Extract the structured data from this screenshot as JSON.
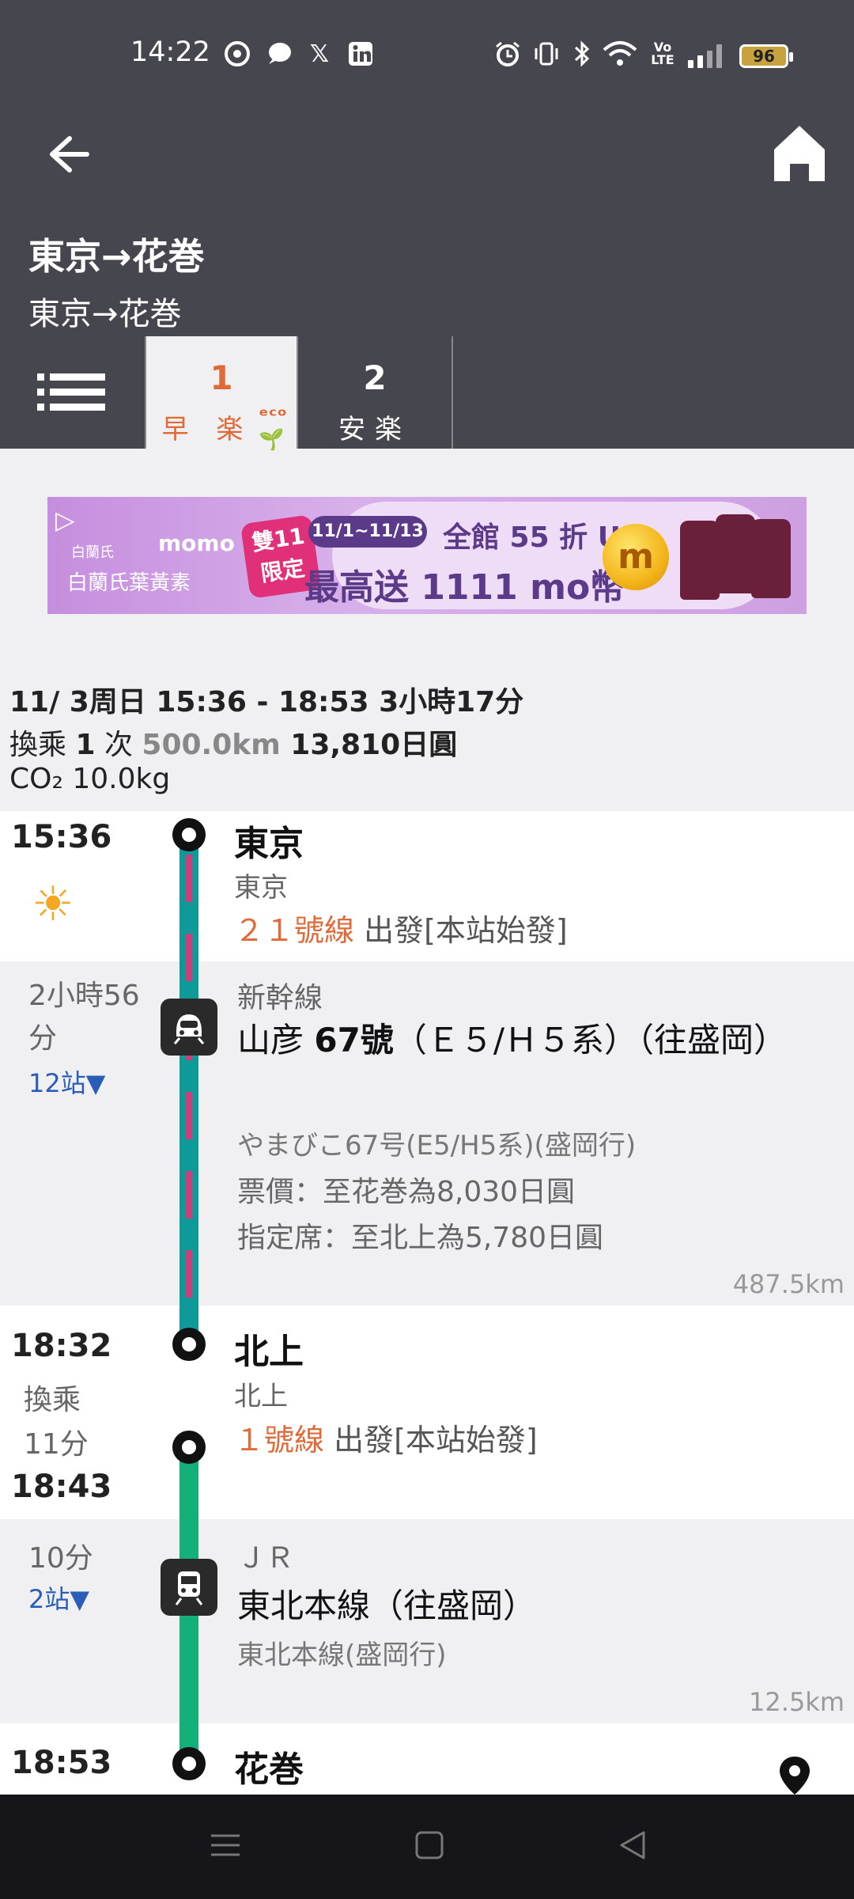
{
  "status_bar": {
    "time": "14:22",
    "battery": "96",
    "icons": [
      "notification-app-icon",
      "chat-bubble-icon",
      "x-icon",
      "linkedin-icon",
      "alarm-icon",
      "vibrate-icon",
      "bluetooth-icon",
      "wifi-icon",
      "volte-icon",
      "signal-icon"
    ]
  },
  "header": {
    "title": "東京→花巻",
    "subtitle": "東京→花巻"
  },
  "tabs": [
    {
      "num": "1",
      "sub": "早 楽"
    },
    {
      "num": "2",
      "sub": "安楽"
    }
  ],
  "ad": {
    "brand1": "白蘭氏",
    "brand2": "白蘭氏葉黃素",
    "momo": "momo",
    "badge": "雙11 限定",
    "date": "11/1~11/13",
    "line1": "全館 55 折 UP",
    "line2": "最高送 1111 mo幣",
    "coin": "m"
  },
  "summary": {
    "date_time": "11/ 3周日 15:36 - 18:53 3小時17分",
    "transfer_pre": "換乘 ",
    "transfer_count": "1",
    "transfer_post": " 次 ",
    "distance": "500.0km",
    "fare": " 13,810日圓",
    "co2": "CO₂ 10.0kg"
  },
  "route": {
    "dep": {
      "time": "15:36",
      "weather": "☀",
      "station": "東京",
      "station_sub": "東京",
      "platform": "２１號線",
      "platform_note": " 出發[本站始發]"
    },
    "leg1": {
      "duration": "2小時56分",
      "stops": "12站▼",
      "category": "新幹線",
      "train_a": "山彦 ",
      "train_b": "67號",
      "train_c": "（Ｅ５/Ｈ５系）（往盛岡）",
      "train_jp": "やまびこ67号(E5/H5系)(盛岡行)",
      "fare1": "票價：至花巻為8,030日圓",
      "fare2": "指定席：至北上為5,780日圓",
      "distance": "487.5km"
    },
    "transfer": {
      "arr_time": "18:32",
      "label": "換乘",
      "wait": "11分",
      "dep_time": "18:43",
      "station": "北上",
      "station_sub": "北上",
      "platform": "１號線",
      "platform_note": " 出發[本站始發]"
    },
    "leg2": {
      "duration": "10分",
      "stops": "2站▼",
      "category": "ＪＲ",
      "train": "東北本線（往盛岡）",
      "train_jp": "東北本線(盛岡行)",
      "distance": "12.5km"
    },
    "arr": {
      "time": "18:53",
      "station": "花巻"
    }
  },
  "colors": {
    "header_bg": "#46464f",
    "accent_orange": "#e06b3a",
    "shinkansen_line": "#0f9a9a",
    "shinkansen_stripe": "#d63a78",
    "jr_line": "#14b07a",
    "stop_link": "#2a5db8"
  }
}
